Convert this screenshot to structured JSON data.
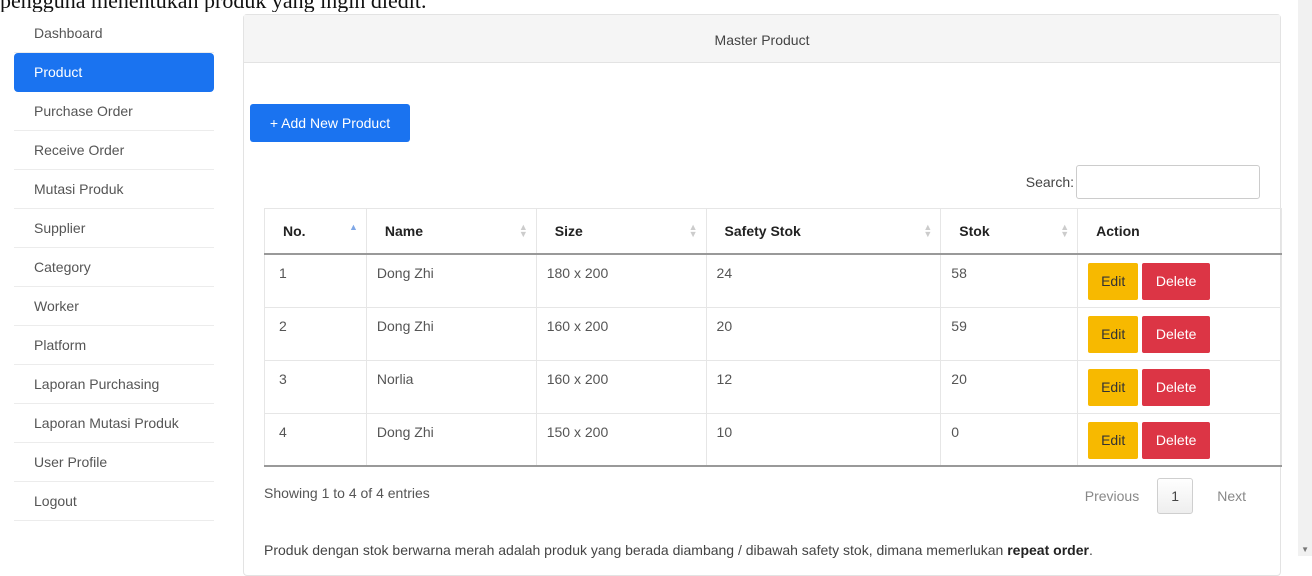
{
  "doc_heading": "pengguna menentukan produk yang ingin diedit.",
  "sidebar": {
    "items": [
      {
        "label": "Dashboard",
        "active": false
      },
      {
        "label": "Product",
        "active": true
      },
      {
        "label": "Purchase Order",
        "active": false
      },
      {
        "label": "Receive Order",
        "active": false
      },
      {
        "label": "Mutasi Produk",
        "active": false
      },
      {
        "label": "Supplier",
        "active": false
      },
      {
        "label": "Category",
        "active": false
      },
      {
        "label": "Worker",
        "active": false
      },
      {
        "label": "Platform",
        "active": false
      },
      {
        "label": "Laporan Purchasing",
        "active": false
      },
      {
        "label": "Laporan Mutasi Produk",
        "active": false
      },
      {
        "label": "User Profile",
        "active": false
      },
      {
        "label": "Logout",
        "active": false
      }
    ]
  },
  "panel": {
    "title": "Master Product",
    "add_button": "+ Add New Product",
    "search_label": "Search:",
    "search_value": ""
  },
  "table": {
    "headers": [
      "No.",
      "Name",
      "Size",
      "Safety Stok",
      "Stok",
      "Action"
    ],
    "rows": [
      {
        "no": "1",
        "name": "Dong Zhi",
        "size": "180 x 200",
        "safety": "24",
        "stok": "58",
        "low": false
      },
      {
        "no": "2",
        "name": "Dong Zhi",
        "size": "160 x 200",
        "safety": "20",
        "stok": "59",
        "low": false
      },
      {
        "no": "3",
        "name": "Norlia",
        "size": "160 x 200",
        "safety": "12",
        "stok": "20",
        "low": false
      },
      {
        "no": "4",
        "name": "Dong Zhi",
        "size": "150 x 200",
        "safety": "10",
        "stok": "0",
        "low": true
      }
    ],
    "edit_label": "Edit",
    "delete_label": "Delete"
  },
  "pagination": {
    "info": "Showing 1 to 4 of 4 entries",
    "previous": "Previous",
    "current_page": "1",
    "next": "Next"
  },
  "note": {
    "text": "Produk dengan stok berwarna merah adalah produk yang berada diambang / dibawah safety stok, dimana memerlukan ",
    "bold": "repeat order",
    "end": "."
  },
  "colors": {
    "primary": "#1a73f0",
    "edit": "#f7b900",
    "delete": "#dc3545",
    "low_stock": "#e53935"
  }
}
